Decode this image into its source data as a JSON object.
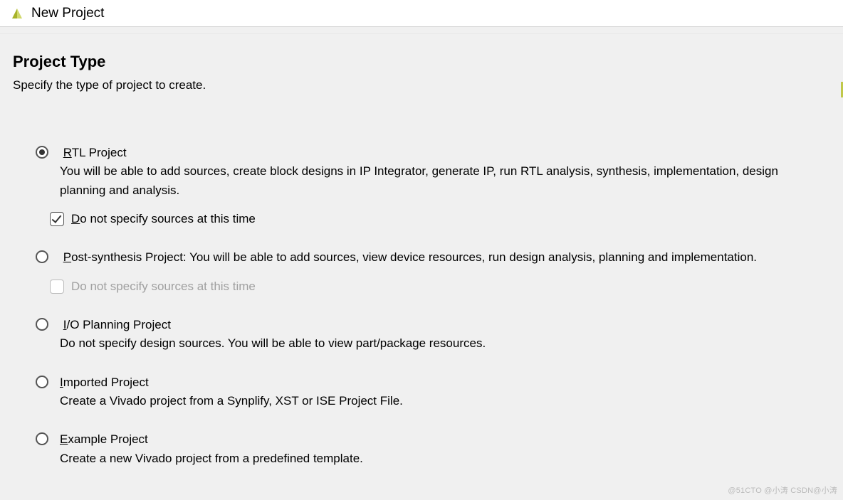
{
  "window": {
    "title": "New Project"
  },
  "header": {
    "title": "Project Type",
    "subtitle": "Specify the type of project to create."
  },
  "options": {
    "rtl": {
      "label_pre": "",
      "label_u": "R",
      "label_rest": "TL Project",
      "desc": "You will be able to add sources, create block designs in IP Integrator, generate IP, run RTL analysis, synthesis, implementation, design planning and analysis.",
      "check_u": "D",
      "check_rest": "o not specify sources at this time"
    },
    "post": {
      "label_pre": "",
      "label_u": "P",
      "label_rest": "ost-synthesis Project: ",
      "desc": "You will be able to add sources, view device resources, run design analysis, planning and implementation.",
      "check": "Do not specify sources at this time"
    },
    "io": {
      "label_u": "I",
      "label_rest": "/O Planning Project",
      "desc": "Do not specify design sources. You will be able to view part/package resources."
    },
    "imported": {
      "label_u": "I",
      "label_rest": "mported Project",
      "desc": "Create a Vivado project from a Synplify, XST or ISE Project File."
    },
    "example": {
      "label_u": "E",
      "label_rest": "xample Project",
      "desc": "Create a new Vivado project from a predefined template."
    }
  },
  "watermark": "@51CTO @小涛  CSDN@小涛"
}
